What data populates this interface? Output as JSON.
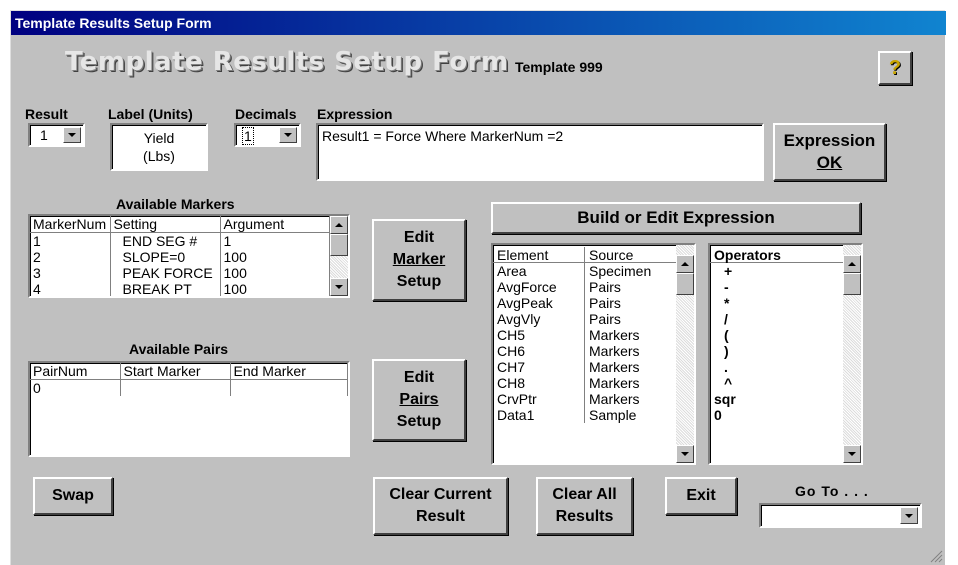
{
  "window": {
    "title": "Template Results Setup Form"
  },
  "header": {
    "embossed_title": "Template Results Setup Form",
    "template_label": "Template 999",
    "help_glyph": "?"
  },
  "fields": {
    "result_label": "Result",
    "result_value": "1",
    "label_units_label": "Label (Units)",
    "label_units_line1": "Yield",
    "label_units_line2": "(Lbs)",
    "decimals_label": "Decimals",
    "decimals_value": "1",
    "expression_label": "Expression",
    "expression_value": "Result1 = Force Where MarkerNum =2"
  },
  "buttons": {
    "expression_ok_line1": "Expression",
    "expression_ok_line2": "OK",
    "edit_marker_line1": "Edit",
    "edit_marker_line2": "Marker",
    "edit_marker_line3": "Setup",
    "edit_pairs_line1": "Edit",
    "edit_pairs_line2": "Pairs",
    "edit_pairs_line3": "Setup",
    "build_expression": "Build or Edit Expression",
    "swap": "Swap",
    "clear_current_line1": "Clear Current",
    "clear_current_line2": "Result",
    "clear_all_line1": "Clear All",
    "clear_all_line2": "Results",
    "exit": "Exit"
  },
  "markers": {
    "title": "Available Markers",
    "columns": [
      "MarkerNum",
      "Setting",
      "Argument"
    ],
    "rows": [
      [
        "1",
        "END SEG #",
        "1"
      ],
      [
        "2",
        "SLOPE=0",
        "100"
      ],
      [
        "3",
        "PEAK FORCE",
        "100"
      ],
      [
        "4",
        "BREAK PT",
        "100"
      ]
    ]
  },
  "pairs": {
    "title": "Available Pairs",
    "columns": [
      "PairNum",
      "Start Marker",
      "End Marker"
    ],
    "rows": [
      [
        "0",
        "",
        ""
      ]
    ]
  },
  "elements": {
    "columns": [
      "Element",
      "Source"
    ],
    "rows": [
      [
        "Area",
        "Specimen"
      ],
      [
        "AvgForce",
        "Pairs"
      ],
      [
        "AvgPeak",
        "Pairs"
      ],
      [
        "AvgVly",
        "Pairs"
      ],
      [
        "CH5",
        "Markers"
      ],
      [
        "CH6",
        "Markers"
      ],
      [
        "CH7",
        "Markers"
      ],
      [
        "CH8",
        "Markers"
      ],
      [
        "CrvPtr",
        "Markers"
      ],
      [
        "Data1",
        "Sample"
      ]
    ]
  },
  "operators": {
    "title": "Operators",
    "items": [
      "+",
      "-",
      "*",
      "/",
      "(",
      ")",
      ".",
      "^",
      "sqr",
      "0"
    ]
  },
  "goto": {
    "label": "Go To . . .",
    "value": ""
  }
}
